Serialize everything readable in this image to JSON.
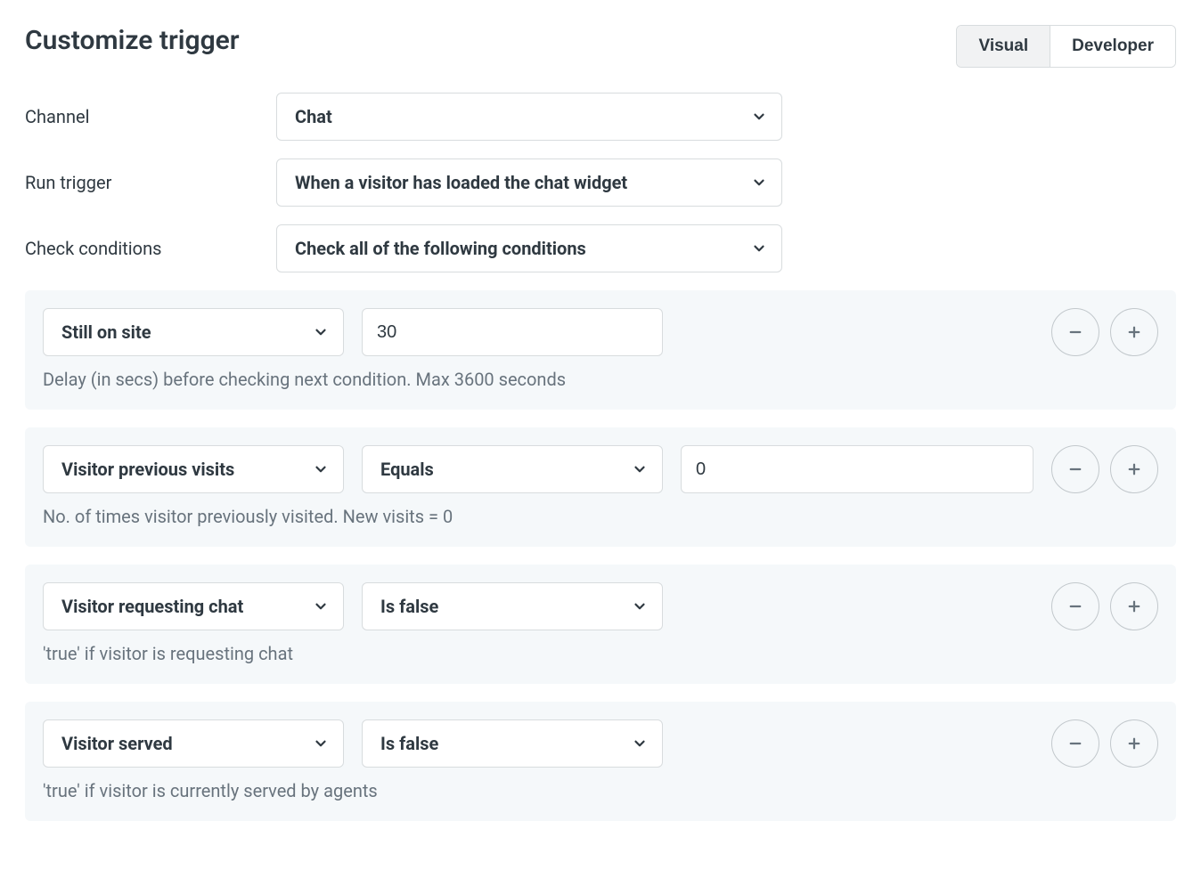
{
  "header": {
    "title": "Customize trigger",
    "tabs": {
      "visual": "Visual",
      "developer": "Developer"
    }
  },
  "form": {
    "channel_label": "Channel",
    "channel_value": "Chat",
    "run_trigger_label": "Run trigger",
    "run_trigger_value": "When a visitor has loaded the chat widget",
    "check_conditions_label": "Check conditions",
    "check_conditions_value": "Check all of the following conditions"
  },
  "conditions": [
    {
      "field": "Still on site",
      "value": "30",
      "help": "Delay (in secs) before checking next condition. Max 3600 seconds"
    },
    {
      "field": "Visitor previous visits",
      "operator": "Equals",
      "value": "0",
      "help": "No. of times visitor previously visited. New visits = 0"
    },
    {
      "field": "Visitor requesting chat",
      "operator": "Is false",
      "help": "'true' if visitor is requesting chat"
    },
    {
      "field": "Visitor served",
      "operator": "Is false",
      "help": "'true' if visitor is currently served by agents"
    }
  ]
}
